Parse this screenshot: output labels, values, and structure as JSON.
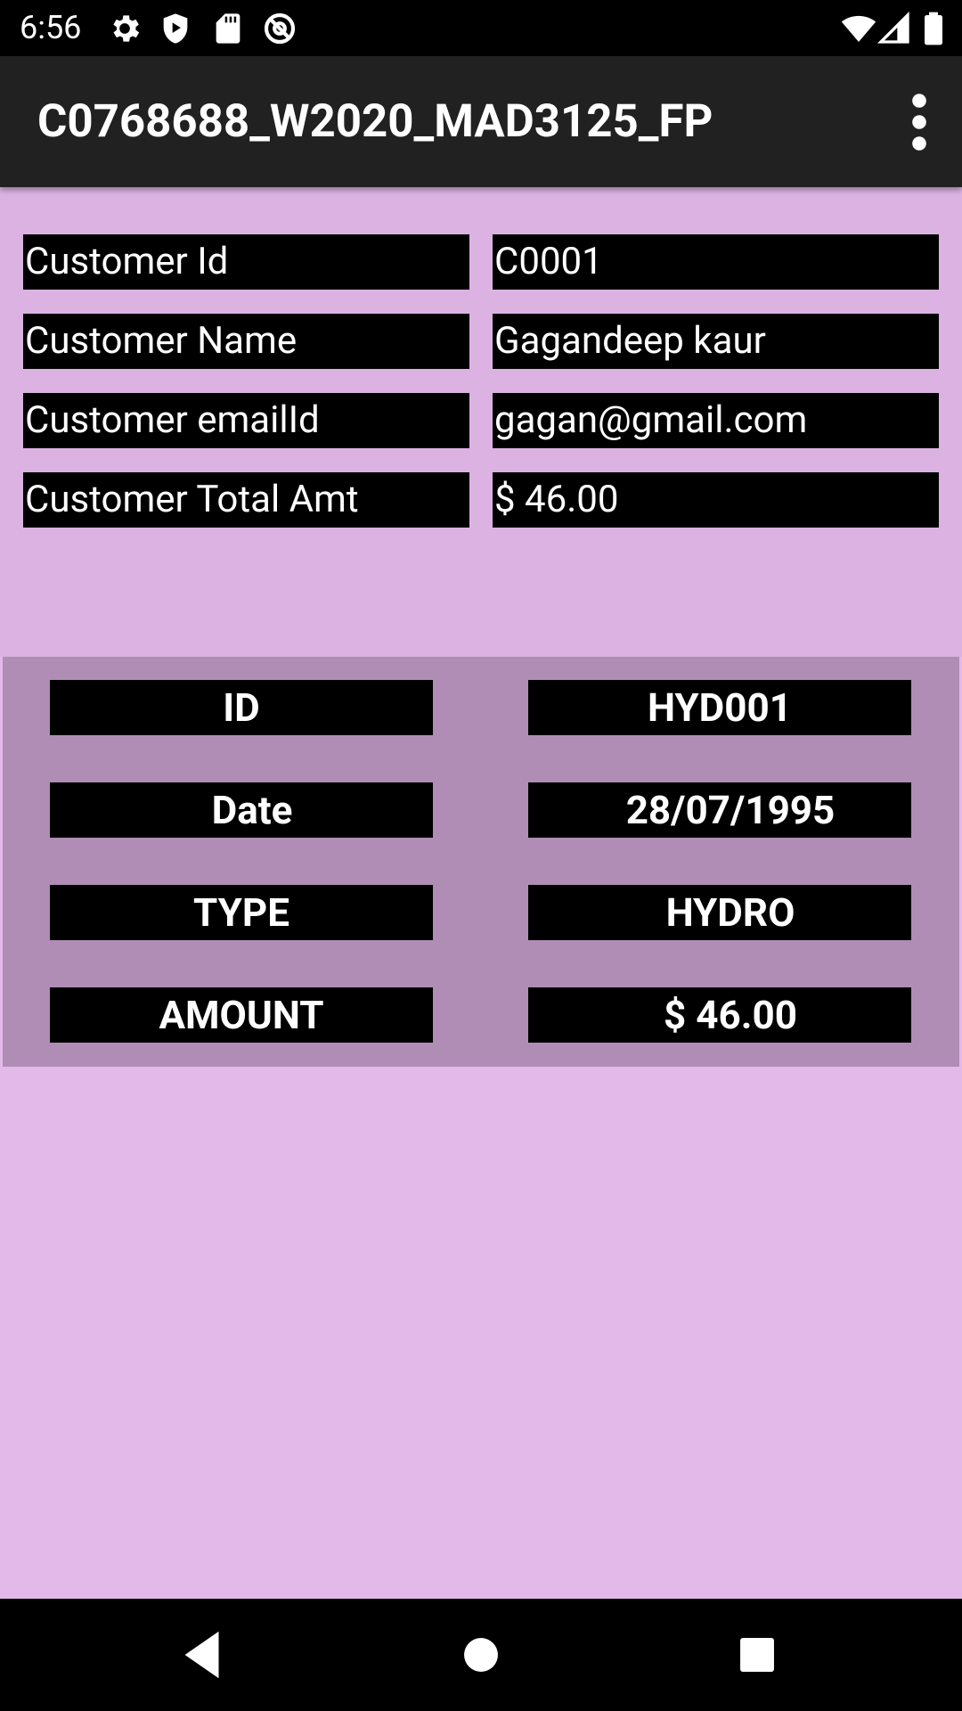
{
  "status_bar": {
    "time": "6:56",
    "left_icons": [
      "gear-icon",
      "shield-play-icon",
      "sd-card-icon",
      "at-circle-icon"
    ],
    "right_icons": [
      "wifi-icon",
      "cell-signal-icon",
      "battery-icon"
    ]
  },
  "app_bar": {
    "title": "C0768688_W2020_MAD3125_FP",
    "overflow_icon": "more-vert-icon"
  },
  "customer": {
    "rows": [
      {
        "label": "Customer Id",
        "value": "C0001"
      },
      {
        "label": "Customer Name",
        "value": "Gagandeep kaur"
      },
      {
        "label": "Customer emailId",
        "value": "gagan@gmail.com"
      },
      {
        "label": "Customer Total Amt",
        "value": "$ 46.00"
      }
    ]
  },
  "bill": {
    "rows": [
      {
        "label": "ID",
        "value": "HYD001"
      },
      {
        "label": "Date",
        "value": "28/07/1995"
      },
      {
        "label": "TYPE",
        "value": "HYDRO"
      },
      {
        "label": "AMOUNT",
        "value": "$ 46.00"
      }
    ]
  },
  "nav_bar": {
    "icons": [
      "back-icon",
      "home-icon",
      "recents-icon"
    ]
  },
  "colors": {
    "status_bar": "#000000",
    "app_bar": "#212121",
    "top_section": "#dbb2e2",
    "bill_card": "#af8db4",
    "screen_bg": "#e3b9ea",
    "cell_bg": "#000000",
    "text": "#ffffff"
  }
}
